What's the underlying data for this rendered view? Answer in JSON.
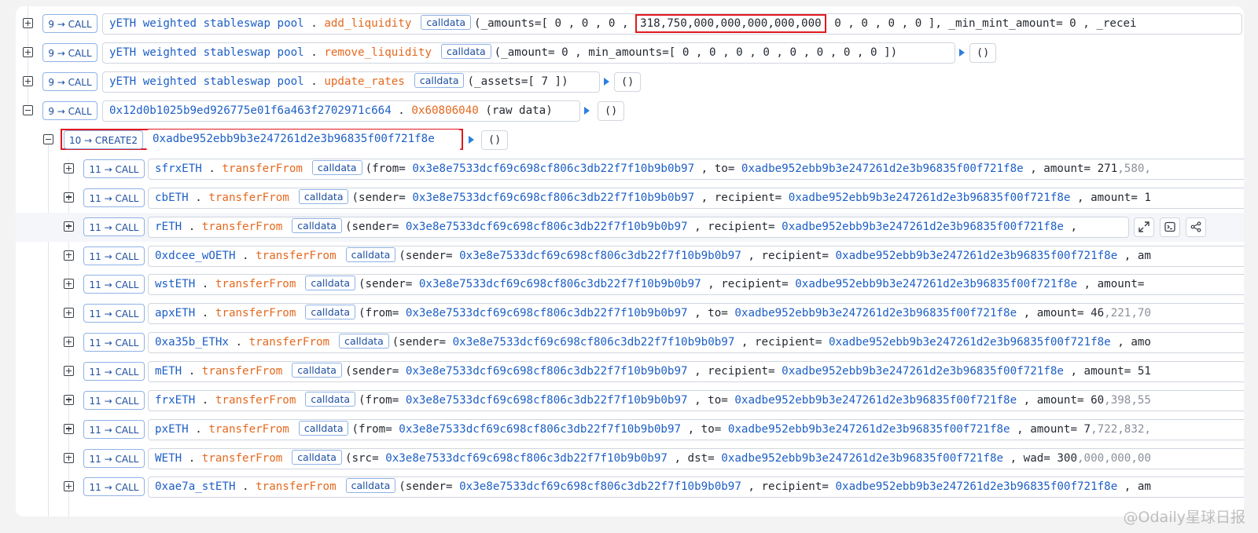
{
  "theme": {
    "contract": "#1d5fc6",
    "function": "#e4691f",
    "badge_border": "#8fb2e6",
    "highlight_box": "#e0191f",
    "expand_arrow": "#2b7fe0"
  },
  "calls": [
    {
      "badge": "9 → CALL",
      "contract": "yETH weighted stableswap pool",
      "fn": "add_liquidity",
      "calldata": "calldata",
      "p1": "(_amounts=[ 0 ,  0 ,  0 , ",
      "highlight": "318,750,000,000,000,000,000",
      "p2": "  0 ,  0 ,  0 ,  0 ], _min_mint_amount= 0 , _recei"
    },
    {
      "badge": "9 → CALL",
      "contract": "yETH weighted stableswap pool",
      "fn": "remove_liquidity",
      "calldata": "calldata",
      "args": "(_amount= 0 , min_amounts=[ 0 ,  0 ,  0 ,  0 ,  0 ,  0 ,  0 ,  0 ])",
      "ret": "()"
    },
    {
      "badge": "9 → CALL",
      "contract": "yETH weighted stableswap pool",
      "fn": "update_rates",
      "calldata": "calldata",
      "args": "(_assets=[ 7 ])",
      "ret": "()"
    },
    {
      "badge": "9 → CALL",
      "contract": "0x12d0b1025b9ed926775e01f6a463f2702971c664",
      "fn": "0x60806040",
      "args": " (raw data)",
      "ret": "()"
    },
    {
      "badge": "10 → CREATE2",
      "contract": "0xadbe952ebb9b3e247261d2e3b96835f00f721f8e",
      "ret": "()"
    }
  ],
  "transfers": [
    {
      "badge": "11 → CALL",
      "token": "sfrxETH",
      "fn": "transferFrom",
      "calldata": "calldata",
      "k1": "(from= ",
      "from": "0x3e8e7533dcf69c698cf806c3db22f7f10b9b0b97",
      "k2": " ,  to= ",
      "to": "0xadbe952ebb9b3e247261d2e3b96835f00f721f8e",
      "k3": " ,  amount= ",
      "amt": "271",
      "amt_rest": ",580,"
    },
    {
      "badge": "11 → CALL",
      "token": "cbETH",
      "fn": "transferFrom",
      "calldata": "calldata",
      "k1": "(sender= ",
      "from": "0x3e8e7533dcf69c698cf806c3db22f7f10b9b0b97",
      "k2": " ,  recipient= ",
      "to": "0xadbe952ebb9b3e247261d2e3b96835f00f721f8e",
      "k3": " ,  amount= ",
      "amt": "1",
      "amt_rest": ""
    },
    {
      "badge": "11 → CALL",
      "token": "rETH",
      "fn": "transferFrom",
      "calldata": "calldata",
      "k1": "(sender= ",
      "from": "0x3e8e7533dcf69c698cf806c3db22f7f10b9b0b97",
      "k2": " ,  recipient= ",
      "to": "0xadbe952ebb9b3e247261d2e3b96835f00f721f8e",
      "k3": " , ",
      "amt": "",
      "amt_rest": ""
    },
    {
      "badge": "11 → CALL",
      "token": "0xdcee_wOETH",
      "fn": "transferFrom",
      "calldata": "calldata",
      "k1": "(sender= ",
      "from": "0x3e8e7533dcf69c698cf806c3db22f7f10b9b0b97",
      "k2": " ,  recipient= ",
      "to": "0xadbe952ebb9b3e247261d2e3b96835f00f721f8e",
      "k3": " ,  am",
      "amt": "",
      "amt_rest": ""
    },
    {
      "badge": "11 → CALL",
      "token": "wstETH",
      "fn": "transferFrom",
      "calldata": "calldata",
      "k1": "(sender= ",
      "from": "0x3e8e7533dcf69c698cf806c3db22f7f10b9b0b97",
      "k2": " ,  recipient= ",
      "to": "0xadbe952ebb9b3e247261d2e3b96835f00f721f8e",
      "k3": " ,  amount= ",
      "amt": "",
      "amt_rest": ""
    },
    {
      "badge": "11 → CALL",
      "token": "apxETH",
      "fn": "transferFrom",
      "calldata": "calldata",
      "k1": "(from= ",
      "from": "0x3e8e7533dcf69c698cf806c3db22f7f10b9b0b97",
      "k2": " ,  to= ",
      "to": "0xadbe952ebb9b3e247261d2e3b96835f00f721f8e",
      "k3": " ,  amount= ",
      "amt": "46",
      "amt_rest": ",221,70"
    },
    {
      "badge": "11 → CALL",
      "token": "0xa35b_ETHx",
      "fn": "transferFrom",
      "calldata": "calldata",
      "k1": "(sender= ",
      "from": "0x3e8e7533dcf69c698cf806c3db22f7f10b9b0b97",
      "k2": " ,  recipient= ",
      "to": "0xadbe952ebb9b3e247261d2e3b96835f00f721f8e",
      "k3": " ,  amo",
      "amt": "",
      "amt_rest": ""
    },
    {
      "badge": "11 → CALL",
      "token": "mETH",
      "fn": "transferFrom",
      "calldata": "calldata",
      "k1": "(sender= ",
      "from": "0x3e8e7533dcf69c698cf806c3db22f7f10b9b0b97",
      "k2": " ,  recipient= ",
      "to": "0xadbe952ebb9b3e247261d2e3b96835f00f721f8e",
      "k3": " ,  amount= ",
      "amt": "51",
      "amt_rest": ""
    },
    {
      "badge": "11 → CALL",
      "token": "frxETH",
      "fn": "transferFrom",
      "calldata": "calldata",
      "k1": "(from= ",
      "from": "0x3e8e7533dcf69c698cf806c3db22f7f10b9b0b97",
      "k2": " ,  to= ",
      "to": "0xadbe952ebb9b3e247261d2e3b96835f00f721f8e",
      "k3": " ,  amount= ",
      "amt": "60",
      "amt_rest": ",398,55"
    },
    {
      "badge": "11 → CALL",
      "token": "pxETH",
      "fn": "transferFrom",
      "calldata": "calldata",
      "k1": "(from= ",
      "from": "0x3e8e7533dcf69c698cf806c3db22f7f10b9b0b97",
      "k2": " ,  to= ",
      "to": "0xadbe952ebb9b3e247261d2e3b96835f00f721f8e",
      "k3": " ,  amount= ",
      "amt": "7",
      "amt_rest": ",722,832,"
    },
    {
      "badge": "11 → CALL",
      "token": "WETH",
      "fn": "transferFrom",
      "calldata": "calldata",
      "k1": "(src= ",
      "from": "0x3e8e7533dcf69c698cf806c3db22f7f10b9b0b97",
      "k2": " ,  dst= ",
      "to": "0xadbe952ebb9b3e247261d2e3b96835f00f721f8e",
      "k3": " ,  wad= ",
      "amt": "300",
      "amt_rest": ",000,000,00"
    },
    {
      "badge": "11 → CALL",
      "token": "0xae7a_stETH",
      "fn": "transferFrom",
      "calldata": "calldata",
      "k1": "(sender= ",
      "from": "0x3e8e7533dcf69c698cf806c3db22f7f10b9b0b97",
      "k2": " ,  recipient= ",
      "to": "0xadbe952ebb9b3e247261d2e3b96835f00f721f8e",
      "k3": " ,  am",
      "amt": "",
      "amt_rest": ""
    }
  ],
  "row_actions": [
    {
      "label": "expand-view",
      "icon": "maximize-icon"
    },
    {
      "label": "console",
      "icon": "terminal-icon"
    },
    {
      "label": "share",
      "icon": "share-icon"
    }
  ],
  "watermark": "@Odaily星球日报"
}
